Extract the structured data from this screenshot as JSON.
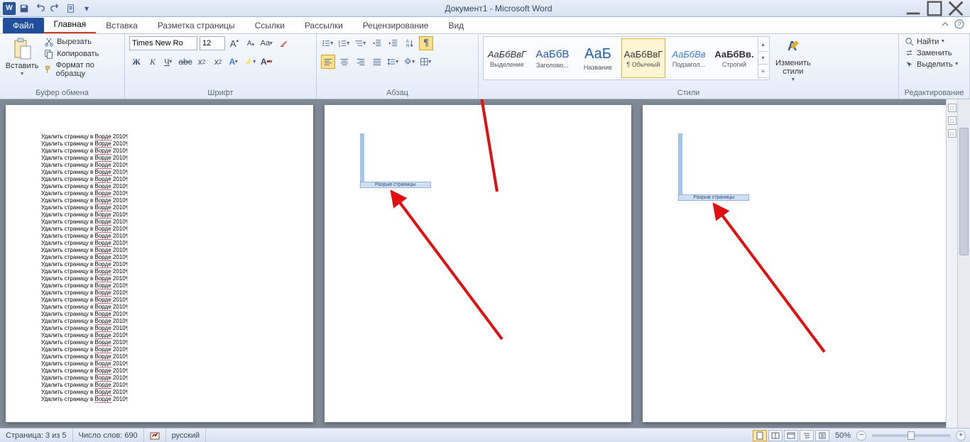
{
  "title": "Документ1 - Microsoft Word",
  "qat": {
    "word": "W"
  },
  "tabs": {
    "file": "Файл",
    "items": [
      "Главная",
      "Вставка",
      "Разметка страницы",
      "Ссылки",
      "Рассылки",
      "Рецензирование",
      "Вид"
    ],
    "active": 0
  },
  "ribbon": {
    "clipboard": {
      "paste": "Вставить",
      "cut": "Вырезать",
      "copy": "Копировать",
      "format_painter": "Формат по образцу",
      "label": "Буфер обмена"
    },
    "font": {
      "name": "Times New Ro",
      "size": "12",
      "label": "Шрифт"
    },
    "paragraph": {
      "label": "Абзац"
    },
    "styles": {
      "label": "Стили",
      "items": [
        {
          "preview": "АаБбВвГ",
          "name": "Выделение"
        },
        {
          "preview": "АаБбВ",
          "name": "Заголово..."
        },
        {
          "preview": "АаБ",
          "name": "Название"
        },
        {
          "preview": "АаБбВвГ",
          "name": "¶ Обычный"
        },
        {
          "preview": "АаБбВв",
          "name": "Подзагол..."
        },
        {
          "preview": "АаБбВв.",
          "name": "Строгий"
        }
      ],
      "change": "Изменить\nстили"
    },
    "editing": {
      "find": "Найти",
      "replace": "Заменить",
      "select": "Выделить",
      "label": "Редактирование"
    }
  },
  "document": {
    "line_text_prefix": "Удалить страницу в ",
    "line_text_err": "Ворде",
    "line_text_suffix": " 2010",
    "line_count": 38,
    "page_break_label": "Разрыв страницы"
  },
  "statusbar": {
    "page": "Страница: 3 из 5",
    "words": "Число слов: 690",
    "lang": "русский",
    "zoom": "50%"
  }
}
